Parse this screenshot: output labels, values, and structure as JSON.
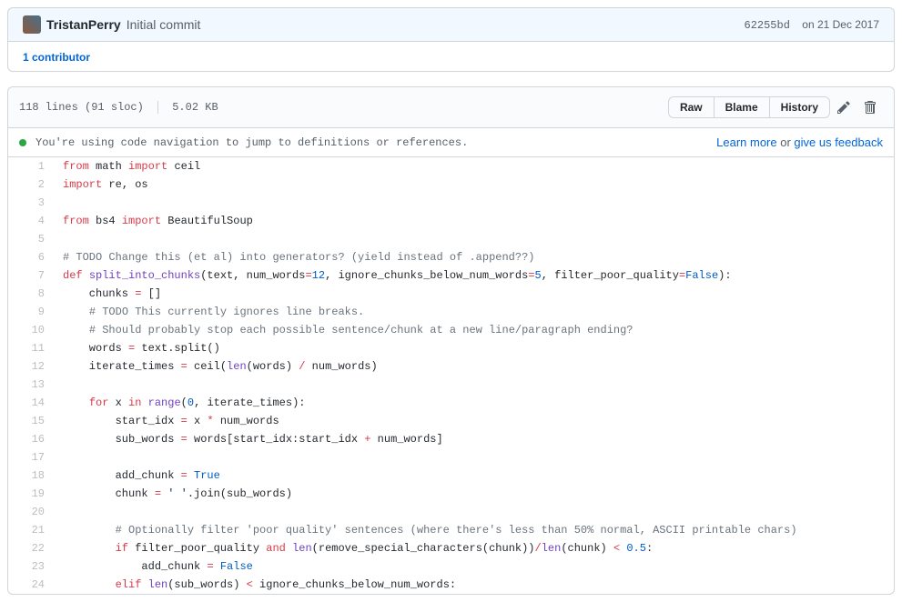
{
  "commit": {
    "author": "TristanPerry",
    "message": "Initial commit",
    "sha": "62255bd",
    "date": "on 21 Dec 2017"
  },
  "contributors": {
    "count_label": "1 contributor"
  },
  "file": {
    "lines_label": "118 lines (91 sloc)",
    "size_label": "5.02 KB",
    "btn_raw": "Raw",
    "btn_blame": "Blame",
    "btn_history": "History"
  },
  "nav_banner": {
    "text": "You're using code navigation to jump to definitions or references.",
    "learn_more": "Learn more",
    "or": " or ",
    "feedback": "give us feedback"
  },
  "code": [
    {
      "n": 1,
      "html": "<span class='kw'>from</span> math <span class='kw'>import</span> ceil"
    },
    {
      "n": 2,
      "html": "<span class='kw'>import</span> re, os"
    },
    {
      "n": 3,
      "html": ""
    },
    {
      "n": 4,
      "html": "<span class='kw'>from</span> bs4 <span class='kw'>import</span> BeautifulSoup"
    },
    {
      "n": 5,
      "html": ""
    },
    {
      "n": 6,
      "html": "<span class='cm'># TODO Change this (et al) into generators? (yield instead of .append??)</span>"
    },
    {
      "n": 7,
      "html": "<span class='kw'>def</span> <span class='fn'>split_into_chunks</span>(text, num_words<span class='op'>=</span><span class='num'>12</span>, ignore_chunks_below_num_words<span class='op'>=</span><span class='num'>5</span>, filter_poor_quality<span class='op'>=</span><span class='bool'>False</span>):"
    },
    {
      "n": 8,
      "html": "    chunks <span class='op'>=</span> []"
    },
    {
      "n": 9,
      "html": "    <span class='cm'># TODO This currently ignores line breaks.</span>"
    },
    {
      "n": 10,
      "html": "    <span class='cm'># Should probably stop each possible sentence/chunk at a new line/paragraph ending?</span>"
    },
    {
      "n": 11,
      "html": "    words <span class='op'>=</span> text.split()"
    },
    {
      "n": 12,
      "html": "    iterate_times <span class='op'>=</span> ceil(<span class='fn'>len</span>(words) <span class='op'>/</span> num_words)"
    },
    {
      "n": 13,
      "html": ""
    },
    {
      "n": 14,
      "html": "    <span class='kw'>for</span> x <span class='kw'>in</span> <span class='fn'>range</span>(<span class='num'>0</span>, iterate_times):"
    },
    {
      "n": 15,
      "html": "        start_idx <span class='op'>=</span> x <span class='op'>*</span> num_words"
    },
    {
      "n": 16,
      "html": "        sub_words <span class='op'>=</span> words[start_idx:start_idx <span class='op'>+</span> num_words]"
    },
    {
      "n": 17,
      "html": ""
    },
    {
      "n": 18,
      "html": "        add_chunk <span class='op'>=</span> <span class='bool'>True</span>"
    },
    {
      "n": 19,
      "html": "        chunk <span class='op'>=</span> <span class='str'>' '</span>.join(sub_words)"
    },
    {
      "n": 20,
      "html": ""
    },
    {
      "n": 21,
      "html": "        <span class='cm'># Optionally filter 'poor quality' sentences (where there's less than 50% normal, ASCII printable chars)</span>"
    },
    {
      "n": 22,
      "html": "        <span class='kw'>if</span> filter_poor_quality <span class='kw'>and</span> <span class='fn'>len</span>(remove_special_characters(chunk))<span class='op'>/</span><span class='fn'>len</span>(chunk) <span class='op'>&lt;</span> <span class='num'>0.5</span>:"
    },
    {
      "n": 23,
      "html": "            add_chunk <span class='op'>=</span> <span class='bool'>False</span>"
    },
    {
      "n": 24,
      "html": "        <span class='kw'>elif</span> <span class='fn'>len</span>(sub_words) <span class='op'>&lt;</span> ignore_chunks_below_num_words:"
    }
  ]
}
